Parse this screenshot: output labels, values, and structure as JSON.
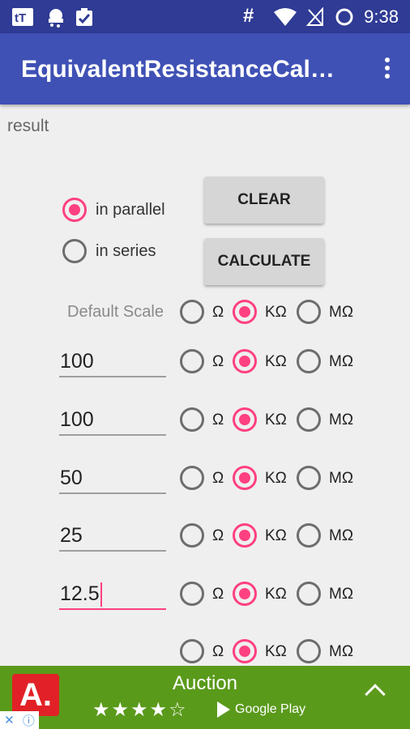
{
  "status_bar": {
    "time": "9:38",
    "icons": [
      "notification-app-icon",
      "weather-icon",
      "clipboard-icon",
      "hash-icon",
      "wifi-icon",
      "signal-off-icon",
      "sync-circle-icon"
    ]
  },
  "app_bar": {
    "title": "EquivalentResistanceCalculator",
    "menu_icon": "more-vert-icon"
  },
  "result_label": "result",
  "mode": {
    "options": [
      {
        "label": "in parallel",
        "selected": true
      },
      {
        "label": "in series",
        "selected": false
      }
    ]
  },
  "buttons": {
    "clear": "CLEAR",
    "calculate": "CALCULATE"
  },
  "default_scale": {
    "label": "Default Scale",
    "selected": "KΩ"
  },
  "units": [
    "Ω",
    "KΩ",
    "MΩ"
  ],
  "rows": [
    {
      "value": "100",
      "unit": "KΩ"
    },
    {
      "value": "100",
      "unit": "KΩ"
    },
    {
      "value": "50",
      "unit": "KΩ"
    },
    {
      "value": "25",
      "unit": "KΩ"
    },
    {
      "value": "12.5",
      "unit": "KΩ",
      "focused": true
    },
    {
      "value": "",
      "unit": "KΩ"
    }
  ],
  "ad": {
    "title": "Auction",
    "rating_stars": "★★★★☆",
    "rating": 4,
    "store": "Google Play",
    "logo_text": "A.",
    "accent": "#5a9a1b"
  }
}
